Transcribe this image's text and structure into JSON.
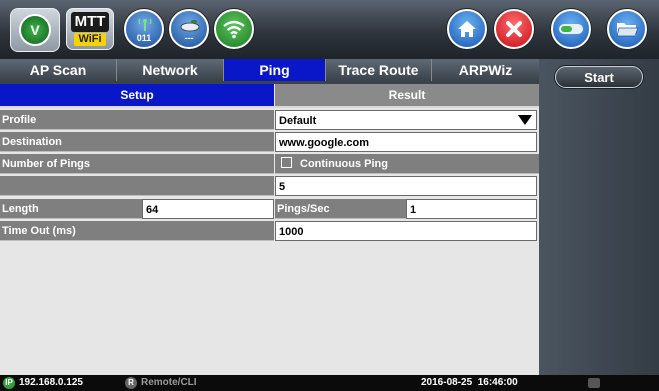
{
  "app": {
    "logo_letter": "V",
    "badge_top": "MTT",
    "badge_bottom": "WiFi"
  },
  "toolbar": {
    "channel_text": "011",
    "dashes_text": "---"
  },
  "tabs": [
    {
      "label": "AP Scan"
    },
    {
      "label": "Network"
    },
    {
      "label": "Ping",
      "active": true
    },
    {
      "label": "Trace Route"
    },
    {
      "label": "ARPWiz"
    }
  ],
  "subtabs": [
    {
      "label": "Setup",
      "active": true
    },
    {
      "label": "Result"
    }
  ],
  "form": {
    "profile_label": "Profile",
    "profile_value": "Default",
    "destination_label": "Destination",
    "destination_value": "www.google.com",
    "pings_label": "Number of Pings",
    "continuous_label": "Continuous Ping",
    "continuous_checked": false,
    "pings_value": "5",
    "length_label": "Length",
    "length_value": "64",
    "pings_per_sec_label": "Pings/Sec",
    "pings_per_sec_value": "1",
    "timeout_label": "Time Out (ms)",
    "timeout_value": "1000"
  },
  "side": {
    "start_label": "Start"
  },
  "status": {
    "ip_badge": "IP",
    "ip": "192.168.0.125",
    "remote_badge": "R",
    "remote": "Remote/CLI",
    "datetime": "2016-08-25  16:46:00"
  },
  "colors": {
    "active_tab": "#0a17c8",
    "label_bg": "#7f7f7f",
    "close": "#e0202a",
    "home": "#1f6fd1",
    "wifi": "#2fa33a"
  }
}
